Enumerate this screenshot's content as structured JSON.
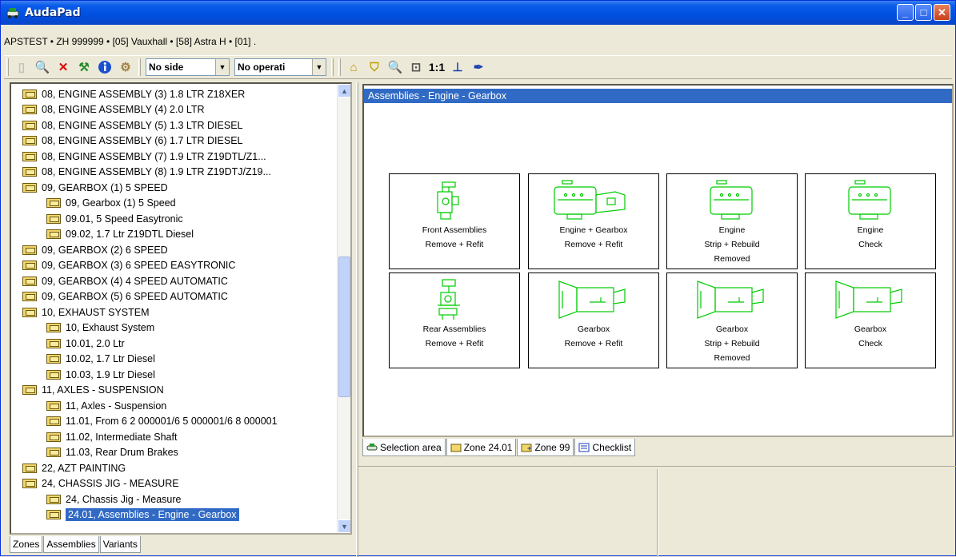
{
  "window": {
    "title": "AudaPad",
    "buttons": {
      "minimize": "_",
      "maximize": "□",
      "close": "✕"
    }
  },
  "path": "APSTEST • ZH 999999 •  [05] Vauxhall • [58] Astra H • [01] .",
  "toolbar": {
    "side_select": "No side",
    "operation_select": "No operati",
    "zoom_label": "1:1"
  },
  "tree": {
    "items": [
      {
        "level": 0,
        "label": "08, ENGINE ASSEMBLY (3) 1.8 LTR Z18XER"
      },
      {
        "level": 0,
        "label": "08, ENGINE ASSEMBLY (4) 2.0 LTR"
      },
      {
        "level": 0,
        "label": "08, ENGINE ASSEMBLY (5) 1.3 LTR DIESEL"
      },
      {
        "level": 0,
        "label": "08, ENGINE ASSEMBLY (6) 1.7 LTR DIESEL"
      },
      {
        "level": 0,
        "label": "08, ENGINE ASSEMBLY (7) 1.9 LTR Z19DTL/Z1..."
      },
      {
        "level": 0,
        "label": "08, ENGINE ASSEMBLY (8) 1.9 LTR Z19DTJ/Z19..."
      },
      {
        "level": 0,
        "label": "09, GEARBOX (1) 5 SPEED"
      },
      {
        "level": 1,
        "label": "09, Gearbox (1) 5 Speed"
      },
      {
        "level": 1,
        "label": "09.01, 5 Speed Easytronic"
      },
      {
        "level": 1,
        "label": "09.02, 1.7 Ltr Z19DTL Diesel"
      },
      {
        "level": 0,
        "label": "09, GEARBOX (2) 6 SPEED"
      },
      {
        "level": 0,
        "label": "09, GEARBOX (3) 6 SPEED EASYTRONIC"
      },
      {
        "level": 0,
        "label": "09, GEARBOX (4) 4 SPEED AUTOMATIC"
      },
      {
        "level": 0,
        "label": "09, GEARBOX (5) 6 SPEED AUTOMATIC"
      },
      {
        "level": 0,
        "label": "10, EXHAUST SYSTEM"
      },
      {
        "level": 1,
        "label": "10, Exhaust System"
      },
      {
        "level": 1,
        "label": "10.01, 2.0 Ltr"
      },
      {
        "level": 1,
        "label": "10.02, 1.7 Ltr Diesel"
      },
      {
        "level": 1,
        "label": "10.03, 1.9 Ltr Diesel"
      },
      {
        "level": 0,
        "label": "11, AXLES - SUSPENSION"
      },
      {
        "level": 1,
        "label": "11, Axles - Suspension"
      },
      {
        "level": 1,
        "label": "11.01, From 6 2 000001/6 5 000001/6 8 000001"
      },
      {
        "level": 1,
        "label": "11.02, Intermediate Shaft"
      },
      {
        "level": 1,
        "label": "11.03, Rear Drum Brakes"
      },
      {
        "level": 0,
        "label": "22, AZT PAINTING"
      },
      {
        "level": 0,
        "label": "24, CHASSIS JIG - MEASURE"
      },
      {
        "level": 1,
        "label": "24, Chassis Jig - Measure"
      },
      {
        "level": 1,
        "label": "24.01, Assemblies - Engine - Gearbox",
        "selected": true
      }
    ]
  },
  "left_tabs": [
    "Zones",
    "Assemblies",
    "Variants"
  ],
  "main": {
    "title": "Assemblies - Engine - Gearbox",
    "cards": [
      {
        "icon": "front-assemblies-icon",
        "l1": "Front Assemblies",
        "l2": "Remove + Refit",
        "l3": ""
      },
      {
        "icon": "engine-gearbox-icon",
        "l1": "Engine + Gearbox",
        "l2": "Remove + Refit",
        "l3": ""
      },
      {
        "icon": "engine-icon",
        "l1": "Engine",
        "l2": "Strip + Rebuild",
        "l3": "Removed"
      },
      {
        "icon": "engine-icon",
        "l1": "Engine",
        "l2": "Check",
        "l3": ""
      },
      {
        "icon": "rear-assemblies-icon",
        "l1": "Rear Assemblies",
        "l2": "Remove + Refit",
        "l3": ""
      },
      {
        "icon": "gearbox-icon",
        "l1": "Gearbox",
        "l2": "Remove + Refit",
        "l3": ""
      },
      {
        "icon": "gearbox-icon",
        "l1": "Gearbox",
        "l2": "Strip + Rebuild",
        "l3": "Removed"
      },
      {
        "icon": "gearbox-icon",
        "l1": "Gearbox",
        "l2": "Check",
        "l3": ""
      }
    ]
  },
  "right_tabs": [
    "Selection area",
    "Zone 24.01",
    "Zone 99",
    "Checklist"
  ],
  "colors": {
    "accent": "#316ac5",
    "diagram": "#00cc00"
  }
}
